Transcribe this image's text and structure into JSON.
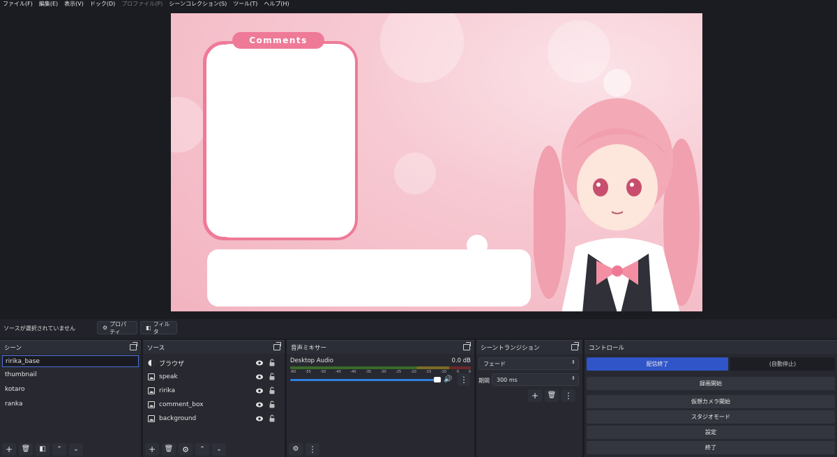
{
  "menu": [
    {
      "label": "ファイル(F)",
      "disabled": false
    },
    {
      "label": "編集(E)",
      "disabled": false
    },
    {
      "label": "表示(V)",
      "disabled": false
    },
    {
      "label": "ドック(D)",
      "disabled": false
    },
    {
      "label": "プロファイル(P)",
      "disabled": true
    },
    {
      "label": "シーンコレクション(S)",
      "disabled": false
    },
    {
      "label": "ツール(T)",
      "disabled": false
    },
    {
      "label": "ヘルプ(H)",
      "disabled": false
    }
  ],
  "preview": {
    "comment_title": "Comments"
  },
  "status": {
    "no_source": "ソースが選択されていません",
    "properties_label": "プロパティ",
    "filters_label": "フィルタ"
  },
  "scenes": {
    "title": "シーン",
    "items": [
      "ririka_base",
      "thumbnail",
      "kotaro",
      "ranka"
    ]
  },
  "sources": {
    "title": "ソース",
    "items": [
      {
        "name": "ブラウザ",
        "icon": "browser-icon"
      },
      {
        "name": "speak",
        "icon": "image-icon"
      },
      {
        "name": "ririka",
        "icon": "image-icon"
      },
      {
        "name": "comment_box",
        "icon": "image-icon"
      },
      {
        "name": "background",
        "icon": "image-icon"
      }
    ]
  },
  "mixer": {
    "title": "音声ミキサー",
    "track_name": "Desktop Audio",
    "db_value": "0.0 dB",
    "ticks": [
      "-60",
      "-55",
      "-50",
      "-45",
      "-40",
      "-35",
      "-30",
      "-25",
      "-20",
      "-15",
      "-10",
      "-5",
      "0"
    ]
  },
  "transitions": {
    "title": "シーントランジション",
    "selected": "フェード",
    "duration_label": "期間",
    "duration_value": "300 ms"
  },
  "controls": {
    "title": "コントロール",
    "stop_stream": "配信終了",
    "auto_stop": "(自動停止)",
    "start_recording": "録画開始",
    "start_virtual_cam": "仮想カメラ開始",
    "studio_mode": "スタジオモード",
    "settings": "設定",
    "exit": "終了"
  },
  "colors": {
    "accent": "#2f55c8",
    "comment_pink": "#ee7a98",
    "panel_bg": "#272830"
  }
}
